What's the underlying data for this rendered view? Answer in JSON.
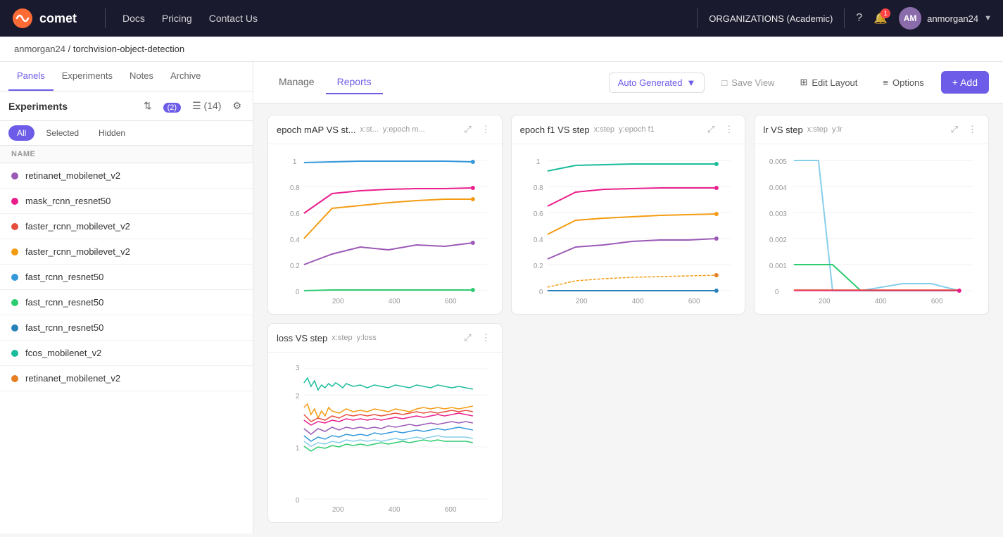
{
  "nav": {
    "logo_text": "comet",
    "links": [
      "Docs",
      "Pricing",
      "Contact Us"
    ],
    "org_name": "ORGANIZATIONS (Academic)",
    "username": "anmorgan24",
    "notification_count": "1"
  },
  "breadcrumb": {
    "user": "anmorgan24",
    "separator": "/",
    "project": "torchvision-object-detection"
  },
  "sidebar": {
    "tabs": [
      "Panels",
      "Experiments",
      "Notes",
      "Archive"
    ],
    "active_tab": "Panels",
    "secondary_tabs": [
      "Manage",
      "Reports"
    ],
    "experiments_title": "Experiments",
    "filter_badge": "(2)",
    "count_badge": "(14)",
    "filter_tabs": [
      "All",
      "Selected",
      "Hidden"
    ],
    "active_filter": "All",
    "col_header": "NAME",
    "experiments": [
      {
        "name": "retinanet_mobilenet_v2",
        "color": "#9b59b6"
      },
      {
        "name": "mask_rcnn_resnet50",
        "color": "#e91e8c"
      },
      {
        "name": "faster_rcnn_mobilevet_v2",
        "color": "#e74c3c"
      },
      {
        "name": "faster_rcnn_mobilevet_v2",
        "color": "#f39c12"
      },
      {
        "name": "fast_rcnn_resnet50",
        "color": "#3498db"
      },
      {
        "name": "fast_rcnn_resnet50",
        "color": "#2ecc71"
      },
      {
        "name": "fast_rcnn_resnet50",
        "color": "#2980b9"
      },
      {
        "name": "fcos_mobilenet_v2",
        "color": "#1abc9c"
      },
      {
        "name": "retinanet_mobilenet_v2",
        "color": "#e67e22"
      }
    ]
  },
  "toolbar": {
    "auto_generated": "Auto Generated",
    "save_view": "Save View",
    "edit_layout": "Edit Layout",
    "options": "Options",
    "add": "+ Add"
  },
  "charts": [
    {
      "id": "chart1",
      "title": "epoch mAP VS st...",
      "x_label": "x:st...",
      "y_label": "y:epoch m...",
      "x_max": 600,
      "y_max": 1.0,
      "x_ticks": [
        200,
        400,
        600
      ],
      "y_ticks": [
        0,
        0.2,
        0.4,
        0.6,
        0.8,
        1
      ]
    },
    {
      "id": "chart2",
      "title": "epoch f1 VS step",
      "x_label": "x:step",
      "y_label": "y:epoch f1",
      "x_max": 600,
      "y_max": 1.0,
      "x_ticks": [
        200,
        400,
        600
      ],
      "y_ticks": [
        0,
        0.2,
        0.4,
        0.6,
        0.8,
        1
      ]
    },
    {
      "id": "chart3",
      "title": "lr VS step",
      "x_label": "x:step",
      "y_label": "y:lr",
      "x_max": 600,
      "y_max": 0.005,
      "x_ticks": [
        200,
        400,
        600
      ],
      "y_ticks": [
        0,
        0.001,
        0.002,
        0.003,
        0.004,
        0.005
      ]
    },
    {
      "id": "chart4",
      "title": "loss VS step",
      "x_label": "x:step",
      "y_label": "y:loss",
      "x_max": 600,
      "y_max": 3,
      "x_ticks": [
        200,
        400,
        600
      ],
      "y_ticks": [
        0,
        1,
        2,
        3
      ]
    }
  ]
}
